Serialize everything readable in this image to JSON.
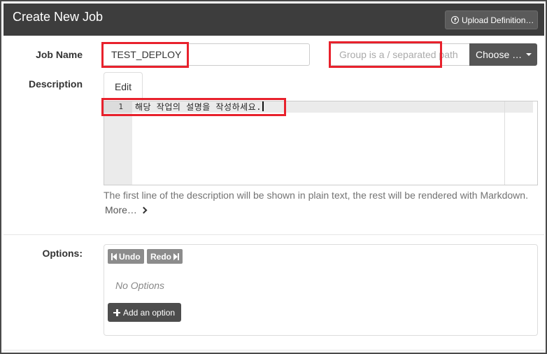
{
  "header": {
    "title": "Create New Job",
    "upload_label": "Upload Definition…"
  },
  "job_name": {
    "label": "Job Name",
    "value": "TEST_DEPLOY"
  },
  "group": {
    "placeholder": "Group is a / separated path",
    "choose_label": "Choose …"
  },
  "description": {
    "label": "Description",
    "tab_label": "Edit",
    "editor": {
      "line_number": "1",
      "line_text": "해당 작업의 설명을 작성하세요."
    },
    "help_text": "The first line of the description will be shown in plain text, the rest will be rendered with Markdown.",
    "more_label": "More…"
  },
  "options": {
    "label": "Options:",
    "undo_label": "Undo",
    "redo_label": "Redo",
    "empty_text": "No Options",
    "add_label": "Add an option"
  },
  "colors": {
    "header_bg": "#3d3d3d",
    "highlight": "#e8212c",
    "button_dark": "#555555"
  },
  "icons": {
    "upload": "upload-circle-icon",
    "caret": "caret-down-icon",
    "more": "chevron-right-icon",
    "undo": "step-backward-icon",
    "redo": "step-forward-icon",
    "add": "plus-icon"
  }
}
